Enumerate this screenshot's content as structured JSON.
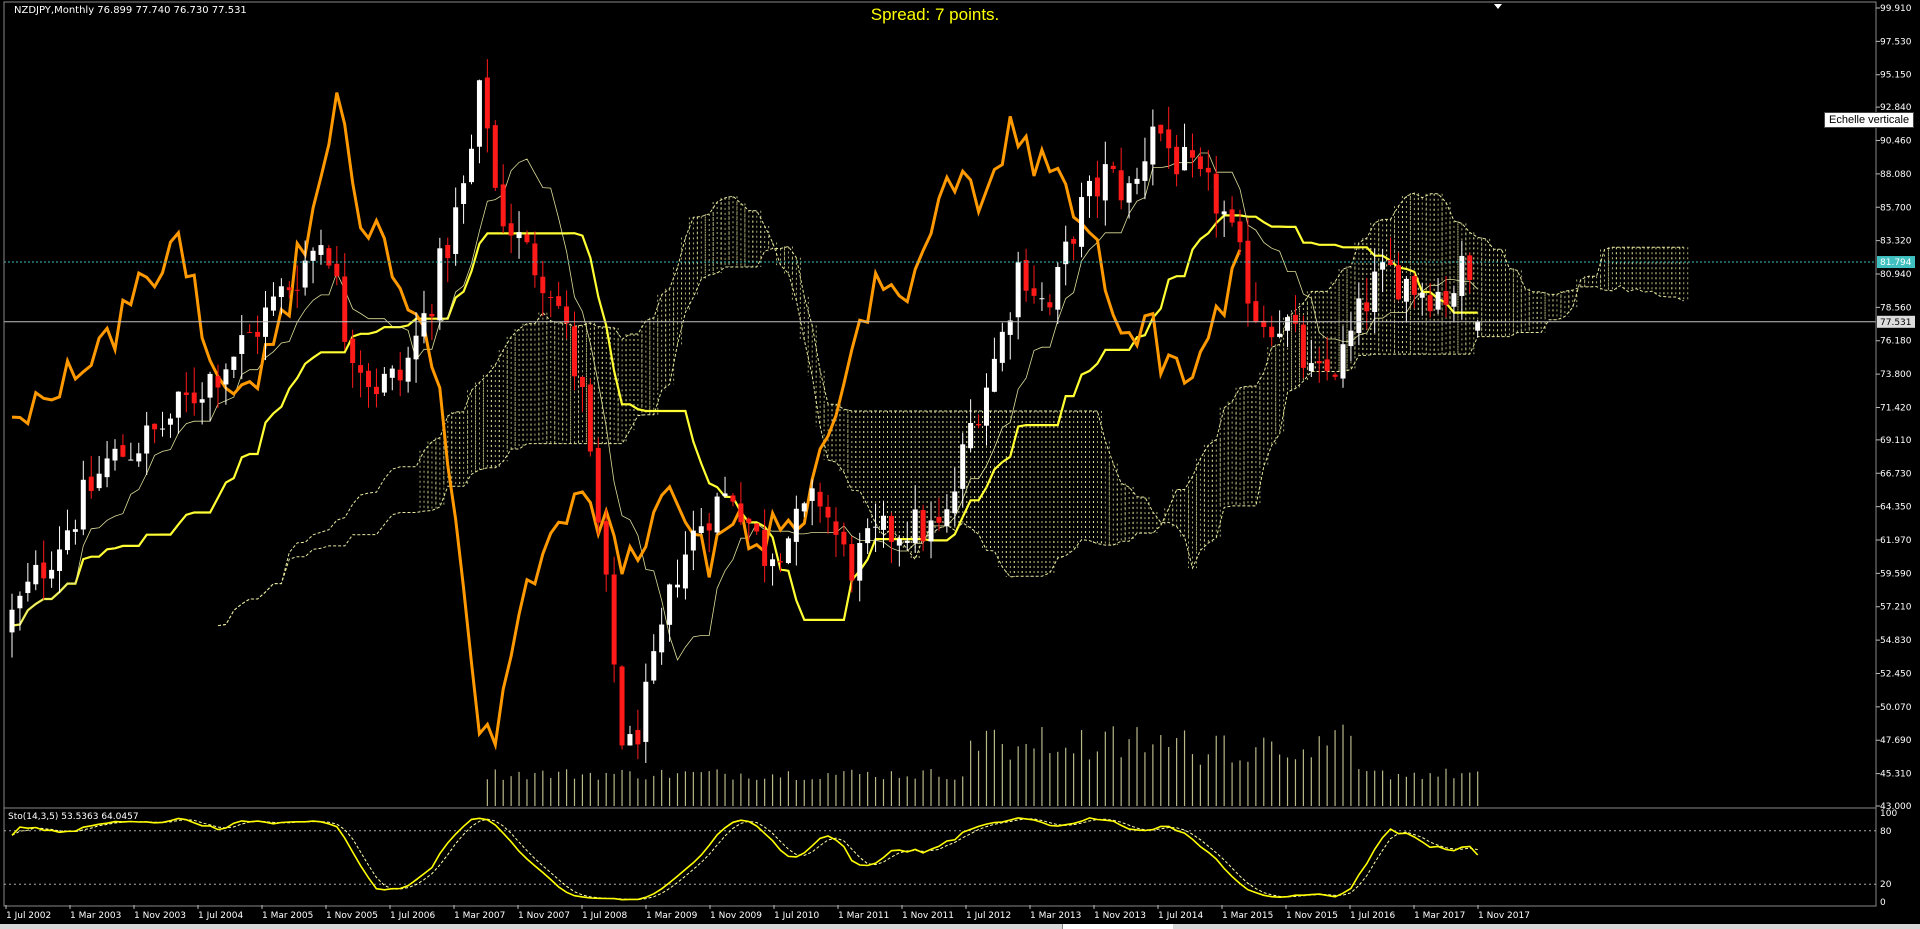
{
  "window": {
    "symbol_info": "NZDJPY,Monthly  76.899 77.740 76.730 77.531",
    "spread": "Spread: 7 points.",
    "tooltip": "Echelle verticale"
  },
  "price_axis": {
    "labels": [
      "99.910",
      "97.530",
      "95.150",
      "92.840",
      "90.460",
      "88.080",
      "85.700",
      "83.320",
      "80.940",
      "78.560",
      "76.180",
      "73.800",
      "71.420",
      "69.110",
      "66.730",
      "64.350",
      "61.970",
      "59.590",
      "57.210",
      "54.830",
      "52.450",
      "50.070",
      "47.690",
      "45.310",
      "43.000"
    ],
    "level_tag": "81.794",
    "current_tag": "77.531",
    "level_price": 81.794,
    "current_price": 77.531
  },
  "stochastic": {
    "label": "Sto(14,3,5) 53.5363 64.0457",
    "axis_labels": [
      "100",
      "80",
      "20",
      "0"
    ],
    "levels": [
      80,
      20
    ]
  },
  "time_axis": {
    "labels": [
      "1 Jul 2002",
      "1 Mar 2003",
      "1 Nov 2003",
      "1 Jul 2004",
      "1 Mar 2005",
      "1 Nov 2005",
      "1 Jul 2006",
      "1 Mar 2007",
      "1 Nov 2007",
      "1 Jul 2008",
      "1 Mar 2009",
      "1 Nov 2009",
      "1 Jul 2010",
      "1 Mar 2011",
      "1 Nov 2011",
      "1 Jul 2012",
      "1 Mar 2013",
      "1 Nov 2013",
      "1 Jul 2014",
      "1 Mar 2015",
      "1 Nov 2015",
      "1 Jul 2016",
      "1 Mar 2017",
      "1 Nov 2017"
    ]
  },
  "colors": {
    "background": "#000000",
    "bull_candle": "#ffffff",
    "bear_candle": "#ff1a1a",
    "kijun": "#ffff33",
    "tenkan": "#dddd99",
    "orange_line": "#ff9900",
    "cloud": "#e8e8a0",
    "volume": "#d8d8a0",
    "level_line": "#40c0c0",
    "current_line": "#c0c0c0",
    "stoch_main": "#ffff00",
    "stoch_signal": "#ffffaa"
  },
  "chart_data": {
    "type": "candlestick",
    "timeframe": "Monthly",
    "symbol": "NZDJPY",
    "x_labels": [
      "1 Jul 2002",
      "1 Mar 2003",
      "1 Nov 2003",
      "1 Jul 2004",
      "1 Mar 2005",
      "1 Nov 2005",
      "1 Jul 2006",
      "1 Mar 2007",
      "1 Nov 2007",
      "1 Jul 2008",
      "1 Mar 2009",
      "1 Nov 2009",
      "1 Jul 2010",
      "1 Mar 2011",
      "1 Nov 2011",
      "1 Jul 2012",
      "1 Mar 2013",
      "1 Nov 2013",
      "1 Jul 2014",
      "1 Mar 2015",
      "1 Nov 2015",
      "1 Jul 2016",
      "1 Mar 2017",
      "1 Nov 2017"
    ],
    "ylim": [
      43.0,
      99.91
    ],
    "close_anchors": [
      [
        2002.5,
        56.5
      ],
      [
        2003.0,
        62.0
      ],
      [
        2003.5,
        67.5
      ],
      [
        2004.0,
        69.5
      ],
      [
        2004.5,
        73.0
      ],
      [
        2005.0,
        76.5
      ],
      [
        2005.5,
        81.0
      ],
      [
        2005.8,
        84.0
      ],
      [
        2006.0,
        77.0
      ],
      [
        2006.3,
        73.0
      ],
      [
        2006.6,
        73.5
      ],
      [
        2006.9,
        79.0
      ],
      [
        2007.3,
        88.0
      ],
      [
        2007.45,
        95.0
      ],
      [
        2007.6,
        86.0
      ],
      [
        2007.9,
        82.5
      ],
      [
        2008.2,
        80.0
      ],
      [
        2008.5,
        72.0
      ],
      [
        2008.75,
        58.0
      ],
      [
        2008.95,
        46.0
      ],
      [
        2009.2,
        51.0
      ],
      [
        2009.5,
        60.0
      ],
      [
        2009.8,
        64.0
      ],
      [
        2010.1,
        65.5
      ],
      [
        2010.4,
        61.0
      ],
      [
        2010.7,
        62.5
      ],
      [
        2011.0,
        65.0
      ],
      [
        2011.3,
        60.0
      ],
      [
        2011.6,
        62.0
      ],
      [
        2011.9,
        63.0
      ],
      [
        2012.3,
        62.5
      ],
      [
        2012.6,
        70.5
      ],
      [
        2012.9,
        76.0
      ],
      [
        2013.1,
        82.0
      ],
      [
        2013.4,
        78.0
      ],
      [
        2013.7,
        85.0
      ],
      [
        2014.0,
        88.0
      ],
      [
        2014.3,
        86.5
      ],
      [
        2014.5,
        92.0
      ],
      [
        2014.7,
        89.5
      ],
      [
        2014.95,
        87.5
      ],
      [
        2015.2,
        86.0
      ],
      [
        2015.6,
        78.0
      ],
      [
        2015.9,
        77.5
      ],
      [
        2016.2,
        73.0
      ],
      [
        2016.5,
        75.0
      ],
      [
        2016.8,
        80.0
      ],
      [
        2017.0,
        81.0
      ],
      [
        2017.3,
        80.0
      ],
      [
        2017.6,
        79.5
      ],
      [
        2017.8,
        81.5
      ],
      [
        2017.92,
        77.5
      ]
    ],
    "last_ohlc": {
      "open": 76.899,
      "high": 77.74,
      "low": 76.73,
      "close": 77.531
    },
    "horizontal_level": 81.794,
    "stochastic": {
      "k": 53.5363,
      "d": 64.0457,
      "k_period": 14,
      "d_period": 3,
      "slowing": 5
    }
  }
}
